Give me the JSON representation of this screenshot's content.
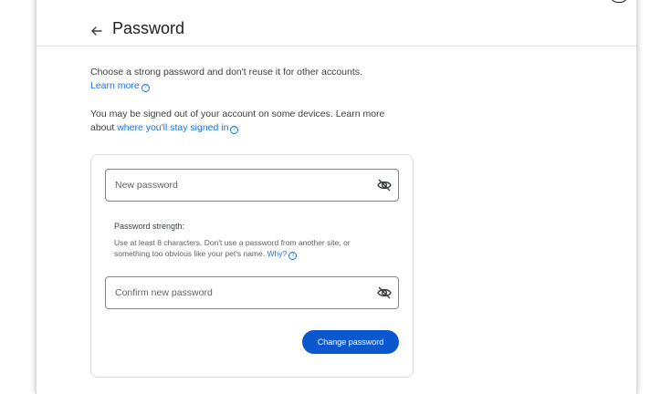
{
  "header": {
    "title": "Password",
    "back_icon": "arrow-left-icon"
  },
  "intro": {
    "text": "Choose a strong password and don't reuse it for other accounts.",
    "learn_more": "Learn more"
  },
  "notice": {
    "text": "You may be signed out of your account on some devices. Learn more about",
    "link": "where you'll stay signed in"
  },
  "form": {
    "new_password_placeholder": "New password",
    "confirm_password_placeholder": "Confirm new password",
    "visibility_icon": "eye-off-icon",
    "strength_title": "Password strength:",
    "strength_desc": "Use at least 8 characters. Don't use a password from another site, or something too obvious like your pet's name.",
    "why_link": "Why?",
    "submit_label": "Change password"
  },
  "colors": {
    "link": "#1a73e8",
    "primary_button": "#0b57d0"
  }
}
